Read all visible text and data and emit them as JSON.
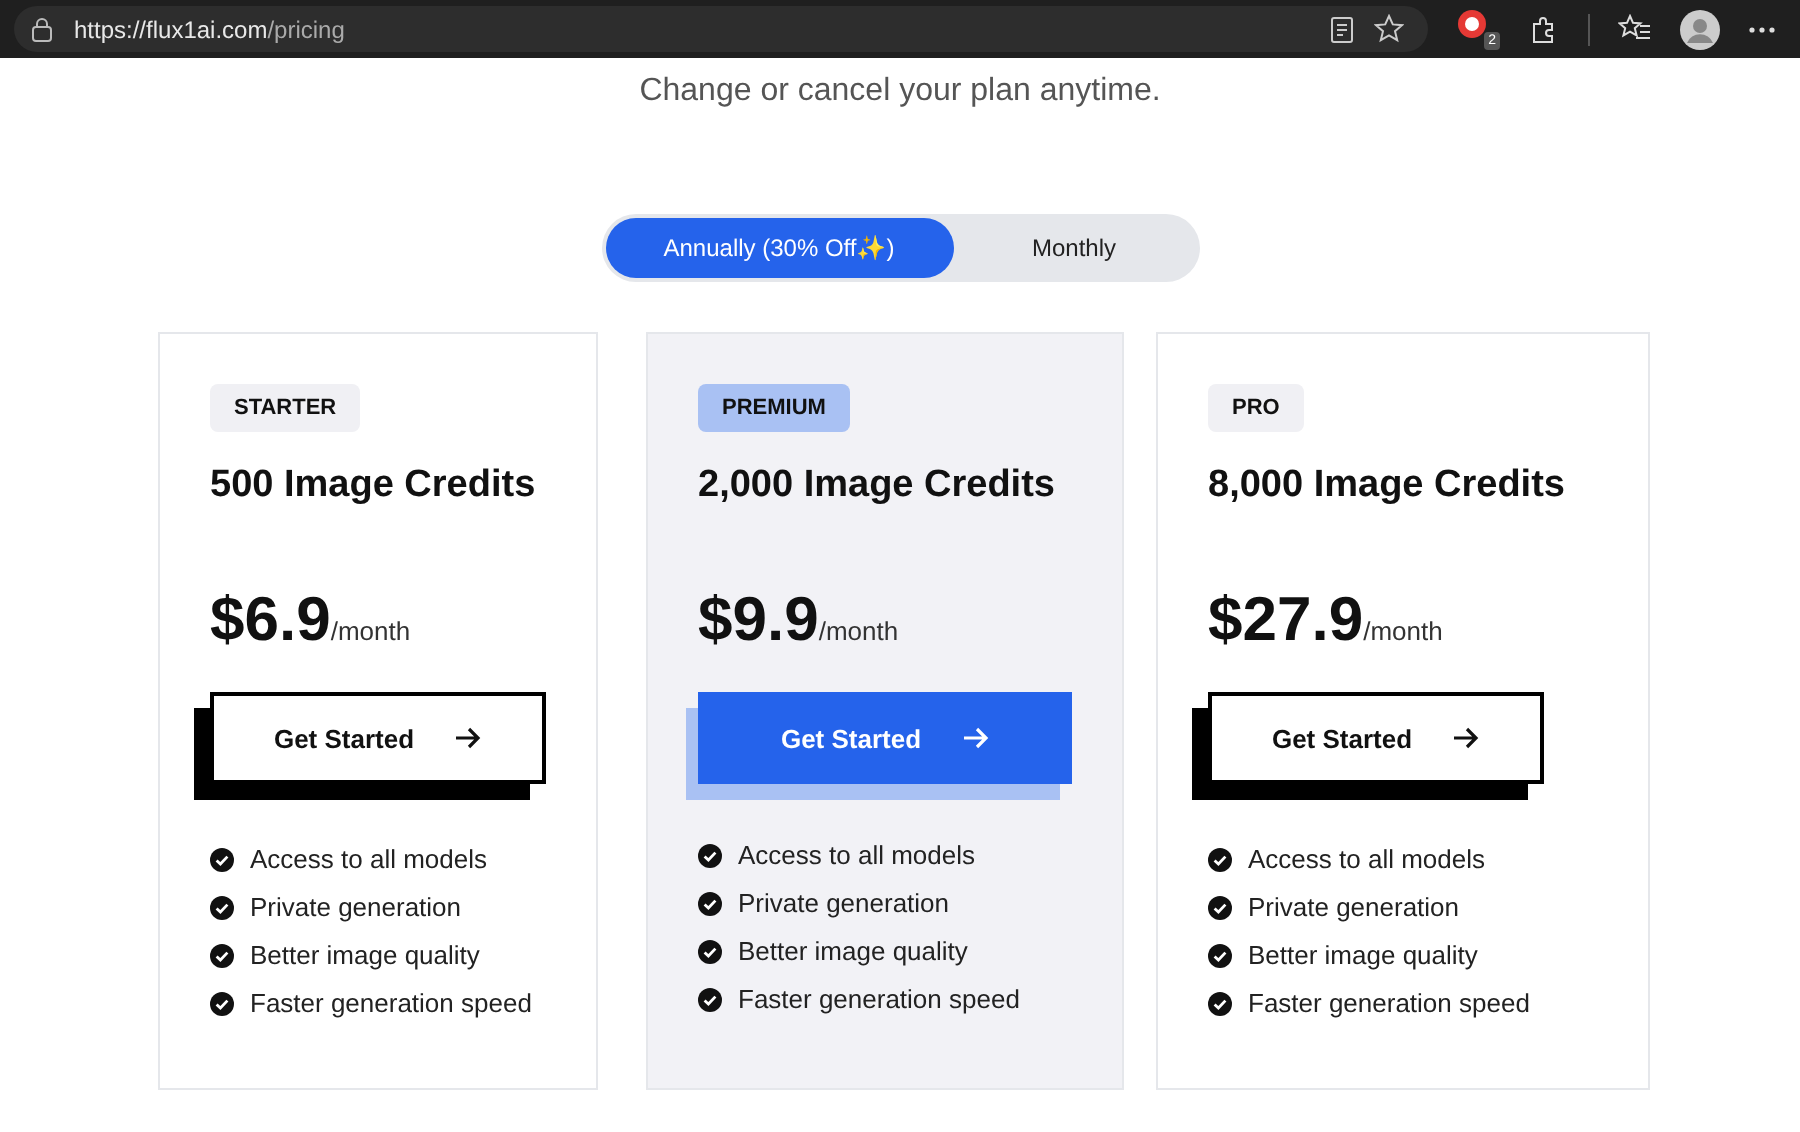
{
  "browser": {
    "url_host": "https://flux1ai.com",
    "url_path": "/pricing",
    "extension_badge": "2"
  },
  "subtitle": "Change or cancel your plan anytime.",
  "billing_toggle": [
    {
      "label": "Annually (30% Off✨)",
      "selected": true
    },
    {
      "label": "Monthly",
      "selected": false
    }
  ],
  "plans": [
    {
      "badge": "STARTER",
      "title": "500 Image Credits",
      "price": "$6.9",
      "period": "/month",
      "button": "Get Started",
      "highlighted": false,
      "features": [
        "Access to all models",
        "Private generation",
        "Better image quality",
        "Faster generation speed"
      ]
    },
    {
      "badge": "PREMIUM",
      "title": "2,000 Image Credits",
      "price": "$9.9",
      "period": "/month",
      "button": "Get Started",
      "highlighted": true,
      "features": [
        "Access to all models",
        "Private generation",
        "Better image quality",
        "Faster generation speed"
      ]
    },
    {
      "badge": "PRO",
      "title": "8,000 Image Credits",
      "price": "$27.9",
      "period": "/month",
      "button": "Get Started",
      "highlighted": false,
      "features": [
        "Access to all models",
        "Private generation",
        "Better image quality",
        "Faster generation speed"
      ]
    }
  ]
}
